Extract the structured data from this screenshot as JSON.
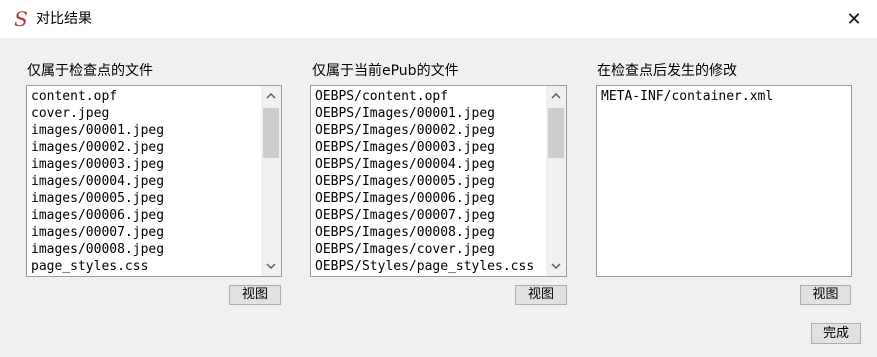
{
  "window": {
    "icon_glyph": "S",
    "title": "对比结果",
    "close_glyph": "✕"
  },
  "panels": [
    {
      "label": "仅属于检查点的文件",
      "items": [
        "content.opf",
        "cover.jpeg",
        "images/00001.jpeg",
        "images/00002.jpeg",
        "images/00003.jpeg",
        "images/00004.jpeg",
        "images/00005.jpeg",
        "images/00006.jpeg",
        "images/00007.jpeg",
        "images/00008.jpeg",
        "page_styles.css"
      ],
      "button_label": "视图"
    },
    {
      "label": "仅属于当前ePub的文件",
      "items": [
        "OEBPS/content.opf",
        "OEBPS/Images/00001.jpeg",
        "OEBPS/Images/00002.jpeg",
        "OEBPS/Images/00003.jpeg",
        "OEBPS/Images/00004.jpeg",
        "OEBPS/Images/00005.jpeg",
        "OEBPS/Images/00006.jpeg",
        "OEBPS/Images/00007.jpeg",
        "OEBPS/Images/00008.jpeg",
        "OEBPS/Images/cover.jpeg",
        "OEBPS/Styles/page_styles.css"
      ],
      "button_label": "视图"
    },
    {
      "label": "在检查点后发生的修改",
      "items": [
        "META-INF/container.xml"
      ],
      "button_label": "视图"
    }
  ],
  "footer": {
    "done_label": "完成"
  },
  "colors": {
    "app_icon": "#b8323a",
    "dialog_bg": "#f0f0f0",
    "scroll_thumb": "#cdcdcd"
  }
}
